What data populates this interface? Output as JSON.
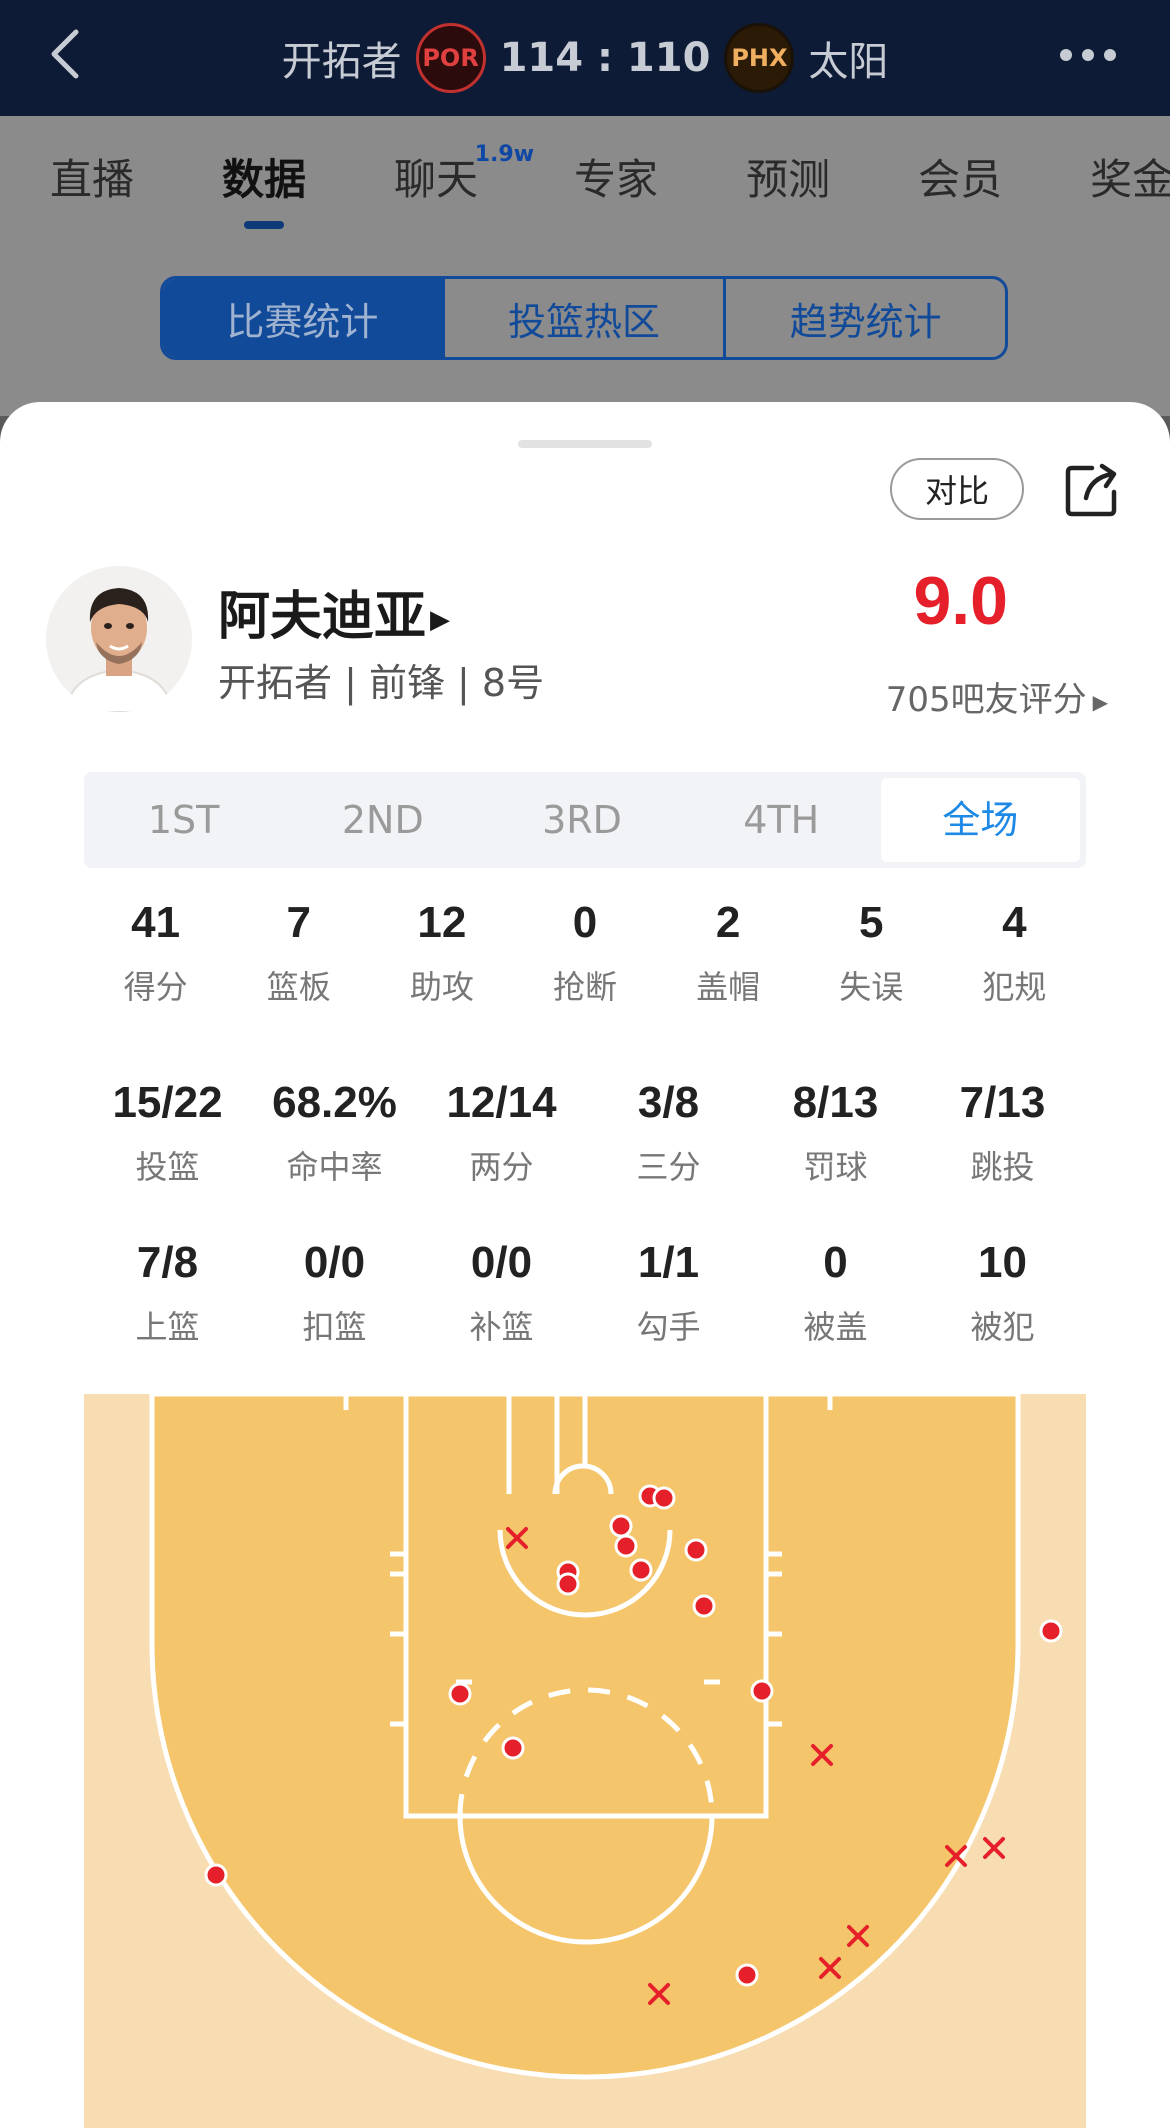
{
  "header": {
    "home_team": "开拓者",
    "home_abbr": "POR",
    "score": "114 : 110",
    "away_abbr": "PHX",
    "away_team": "太阳"
  },
  "nav_tabs": [
    {
      "label": "直播"
    },
    {
      "label": "数据",
      "active": true
    },
    {
      "label": "聊天",
      "badge": "1.9w"
    },
    {
      "label": "专家"
    },
    {
      "label": "预测"
    },
    {
      "label": "会员"
    },
    {
      "label": "奖金"
    }
  ],
  "segments": [
    "比赛统计",
    "投篮热区",
    "趋势统计"
  ],
  "sheet": {
    "compare_label": "对比",
    "player_name": "阿夫迪亚",
    "player_info": "开拓者 | 前锋 | 8号",
    "rating": "9.0",
    "rating_label": "705吧友评分"
  },
  "periods": [
    "1ST",
    "2ND",
    "3RD",
    "4TH",
    "全场"
  ],
  "active_period": "全场",
  "stats_row1": [
    {
      "value": "41",
      "label": "得分"
    },
    {
      "value": "7",
      "label": "篮板"
    },
    {
      "value": "12",
      "label": "助攻"
    },
    {
      "value": "0",
      "label": "抢断"
    },
    {
      "value": "2",
      "label": "盖帽"
    },
    {
      "value": "5",
      "label": "失误"
    },
    {
      "value": "4",
      "label": "犯规"
    }
  ],
  "stats_row2": [
    {
      "value": "15/22",
      "label": "投篮"
    },
    {
      "value": "68.2%",
      "label": "命中率"
    },
    {
      "value": "12/14",
      "label": "两分"
    },
    {
      "value": "3/8",
      "label": "三分"
    },
    {
      "value": "8/13",
      "label": "罚球"
    },
    {
      "value": "7/13",
      "label": "跳投"
    }
  ],
  "stats_row3": [
    {
      "value": "7/8",
      "label": "上篮"
    },
    {
      "value": "0/0",
      "label": "扣篮"
    },
    {
      "value": "0/0",
      "label": "补篮"
    },
    {
      "value": "1/1",
      "label": "勾手"
    },
    {
      "value": "0",
      "label": "被盖"
    },
    {
      "value": "10",
      "label": "被犯"
    }
  ],
  "colors": {
    "made": "#e5202a",
    "missed": "#e5202a",
    "court_inner": "#f5c56b",
    "court_outer": "#f8ddb3",
    "rating": "#e5202a",
    "accent": "#1f8ae6"
  },
  "shot_chart": {
    "made_count": 15,
    "missed_count": 7
  }
}
